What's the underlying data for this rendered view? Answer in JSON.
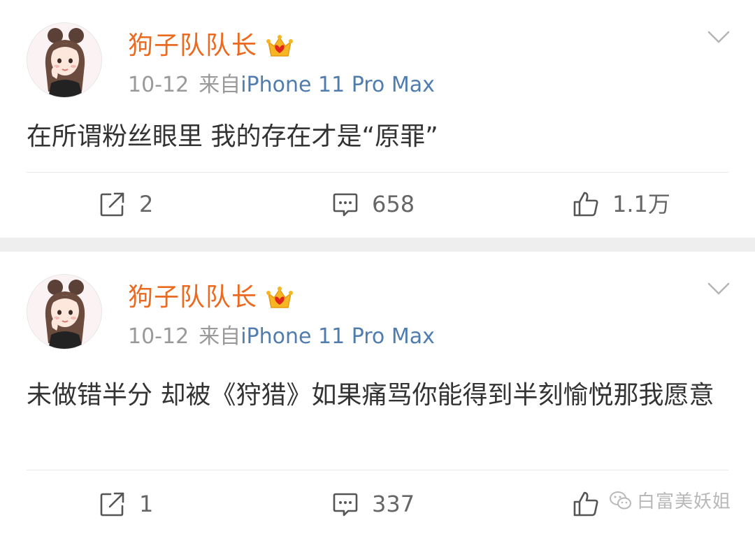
{
  "posts": [
    {
      "username": "狗子队队长",
      "time": "10-12",
      "source_prefix": "来自",
      "device": "iPhone 11 Pro Max",
      "content": "在所谓粉丝眼里 我的存在才是“原罪”",
      "reposts": "2",
      "comments": "658",
      "likes": "1.1万"
    },
    {
      "username": "狗子队队长",
      "time": "10-12",
      "source_prefix": "来自",
      "device": "iPhone 11 Pro Max",
      "content": "未做错半分 却被《狩猎》如果痛骂你能得到半刻愉悦那我愿意",
      "reposts": "1",
      "comments": "337",
      "likes": ""
    }
  ],
  "watermark": "白富美妖姐",
  "colors": {
    "username": "#ec6a20",
    "device_link": "#507daf",
    "meta_gray": "#999999",
    "separator": "#eeeeee"
  },
  "icons": {
    "repost": "square-arrow-icon",
    "comment": "speech-bubble-icon",
    "like": "thumbs-up-icon",
    "badge": "crown-badge-icon",
    "menu": "chevron-down-icon",
    "watermark": "wechat-icon"
  }
}
